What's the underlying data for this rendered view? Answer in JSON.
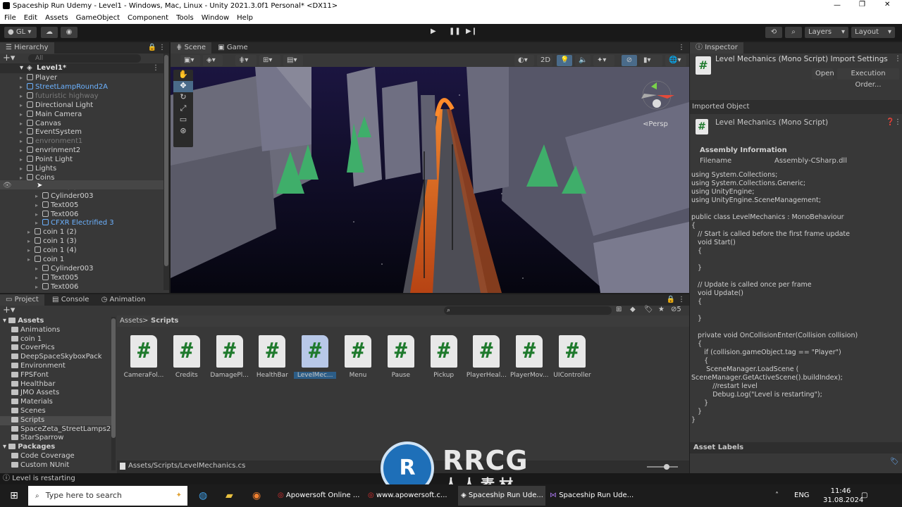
{
  "window": {
    "title": "Spaceship Run Udemy - Level1 - Windows, Mac, Linux - Unity 2021.3.0f1 Personal* <DX11>"
  },
  "menu": [
    "File",
    "Edit",
    "Assets",
    "GameObject",
    "Component",
    "Tools",
    "Window",
    "Help"
  ],
  "toolbar": {
    "account": "GL",
    "layers": "Layers",
    "layout": "Layout"
  },
  "hierarchy": {
    "tab": "Hierarchy",
    "search_placeholder": "All",
    "scene": "Level1*",
    "items": [
      {
        "label": "Player",
        "indent": 1,
        "style": "n"
      },
      {
        "label": "StreetLampRound2A",
        "indent": 1,
        "style": "blue"
      },
      {
        "label": "futuristic highway",
        "indent": 1,
        "style": "grey"
      },
      {
        "label": "Directional Light",
        "indent": 1,
        "style": "n"
      },
      {
        "label": "Main Camera",
        "indent": 1,
        "style": "n"
      },
      {
        "label": "Canvas",
        "indent": 1,
        "style": "n"
      },
      {
        "label": "EventSystem",
        "indent": 1,
        "style": "n"
      },
      {
        "label": "envronment1",
        "indent": 1,
        "style": "grey"
      },
      {
        "label": "envrinment2",
        "indent": 1,
        "style": "n"
      },
      {
        "label": "Point Light",
        "indent": 1,
        "style": "n"
      },
      {
        "label": "Lights",
        "indent": 1,
        "style": "n"
      },
      {
        "label": "Coins",
        "indent": 1,
        "style": "n"
      },
      {
        "label": "coin 1 (1)",
        "indent": 2,
        "style": "n"
      },
      {
        "label": "Cylinder003",
        "indent": 3,
        "style": "n"
      },
      {
        "label": "Text005",
        "indent": 3,
        "style": "n"
      },
      {
        "label": "Text006",
        "indent": 3,
        "style": "n"
      },
      {
        "label": "CFXR Electrified 3",
        "indent": 3,
        "style": "blue"
      },
      {
        "label": "coin 1 (2)",
        "indent": 2,
        "style": "n"
      },
      {
        "label": "coin 1 (3)",
        "indent": 2,
        "style": "n"
      },
      {
        "label": "coin 1 (4)",
        "indent": 2,
        "style": "n"
      },
      {
        "label": "coin 1",
        "indent": 2,
        "style": "n"
      },
      {
        "label": "Cylinder003",
        "indent": 3,
        "style": "n"
      },
      {
        "label": "Text005",
        "indent": 3,
        "style": "n"
      },
      {
        "label": "Text006",
        "indent": 3,
        "style": "n"
      }
    ]
  },
  "scene": {
    "tab_scene": "Scene",
    "tab_game": "Game",
    "mode_2d": "2D",
    "persp": "Persp"
  },
  "inspector": {
    "tab": "Inspector",
    "title": "Level Mechanics (Mono Script) Import Settings",
    "open": "Open",
    "exec_order": "Execution Order...",
    "imported_object": "Imported Object",
    "object_name": "Level Mechanics (Mono Script)",
    "assembly_info": "Assembly Information",
    "filename_label": "Filename",
    "filename_value": "Assembly-CSharp.dll",
    "asset_labels": "Asset Labels",
    "code": "using System.Collections;\nusing System.Collections.Generic;\nusing UnityEngine;\nusing UnityEngine.SceneManagement;\n\npublic class LevelMechanics : MonoBehaviour\n{\n   // Start is called before the first frame update\n   void Start()\n   {\n\n   }\n\n   // Update is called once per frame\n   void Update()\n   {\n\n   }\n\n   private void OnCollisionEnter(Collision collision)\n   {\n      if (collision.gameObject.tag == \"Player\")\n      {\n       SceneManager.LoadScene (\nSceneManager.GetActiveScene().buildIndex);\n          //restart level\n          Debug.Log(\"Level is restarting\");\n      }\n   }\n}"
  },
  "project": {
    "tab_project": "Project",
    "tab_console": "Console",
    "tab_animation": "Animation",
    "breadcrumb_root": "Assets",
    "breadcrumb_leaf": "Scripts",
    "hidden_count": "5",
    "path": "Assets/Scripts/LevelMechanics.cs",
    "folders": [
      {
        "label": "Assets",
        "indent": 0,
        "bold": true
      },
      {
        "label": "Animations",
        "indent": 1
      },
      {
        "label": "coin 1",
        "indent": 1
      },
      {
        "label": "CoverPics",
        "indent": 1
      },
      {
        "label": "DeepSpaceSkyboxPack",
        "indent": 1
      },
      {
        "label": "Environment",
        "indent": 1
      },
      {
        "label": "FPSFont",
        "indent": 1
      },
      {
        "label": "Healthbar",
        "indent": 1
      },
      {
        "label": "JMO Assets",
        "indent": 1
      },
      {
        "label": "Materials",
        "indent": 1
      },
      {
        "label": "Scenes",
        "indent": 1
      },
      {
        "label": "Scripts",
        "indent": 1
      },
      {
        "label": "SpaceZeta_StreetLamps2",
        "indent": 1
      },
      {
        "label": "StarSparrow",
        "indent": 1
      },
      {
        "label": "Packages",
        "indent": 0,
        "bold": true
      },
      {
        "label": "Code Coverage",
        "indent": 1
      },
      {
        "label": "Custom NUnit",
        "indent": 1
      }
    ],
    "scripts": [
      "CameraFol...",
      "Credits",
      "DamagePl...",
      "HealthBar",
      "LevelMec...",
      "Menu",
      "Pause",
      "Pickup",
      "PlayerHeal...",
      "PlayerMov...",
      "UIController"
    ]
  },
  "status": {
    "message": "Level is restarting"
  },
  "taskbar": {
    "search_placeholder": "Type here to search",
    "apps": [
      "Apowersoft Online ...",
      "www.apowersoft.c...",
      "Spaceship Run Ude...",
      "Spaceship Run Ude..."
    ],
    "lang": "ENG",
    "time": "11:46",
    "date": "31.08.2024"
  },
  "watermark": {
    "brand": "RRCG",
    "sub": "人人素材"
  },
  "colors": {
    "accent": "#6cb2ff",
    "selected": "#2c5d87"
  }
}
